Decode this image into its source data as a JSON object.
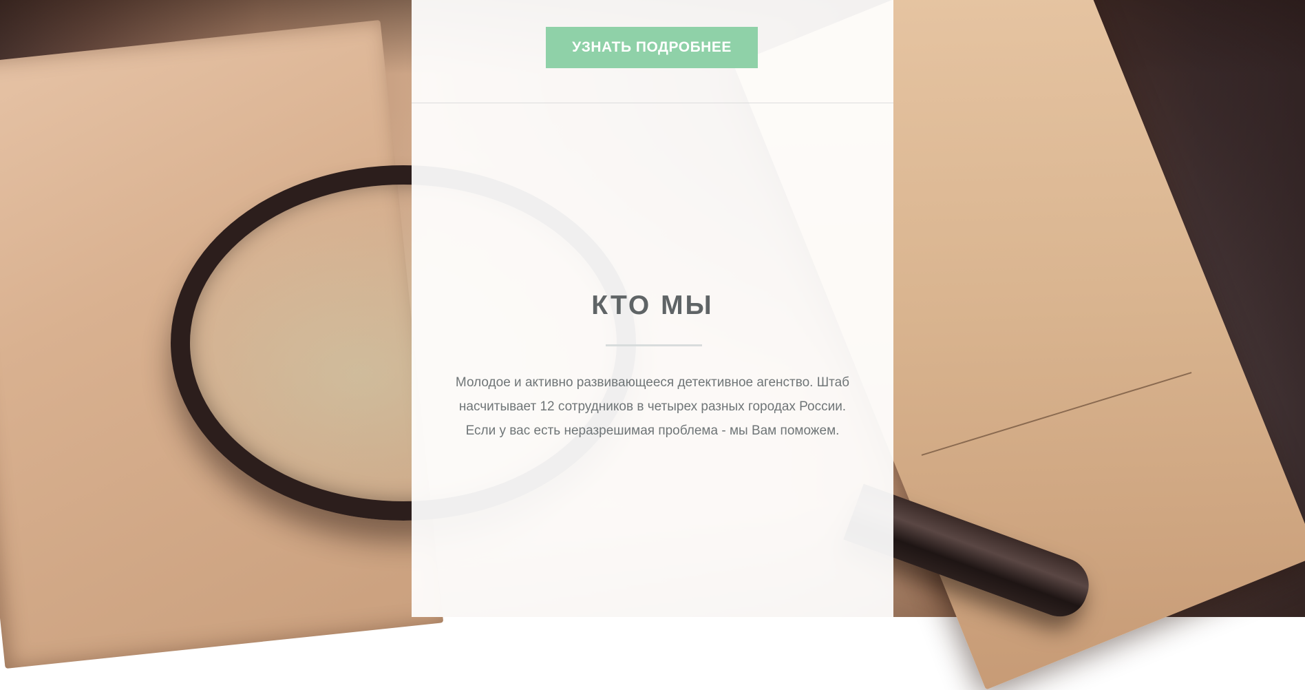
{
  "hero": {
    "cta_label": "УЗНАТЬ ПОДРОБНЕЕ"
  },
  "about": {
    "title": "КТО МЫ",
    "description": "Молодое и активно развивающееся детективное агенство. Штаб насчитывает 12 сотрудников в четырех разных городах России. Если у вас есть неразрешимая проблема - мы Вам поможем."
  },
  "colors": {
    "accent": "#8fd1a8",
    "title": "#5f6466",
    "text": "#6f7577"
  }
}
